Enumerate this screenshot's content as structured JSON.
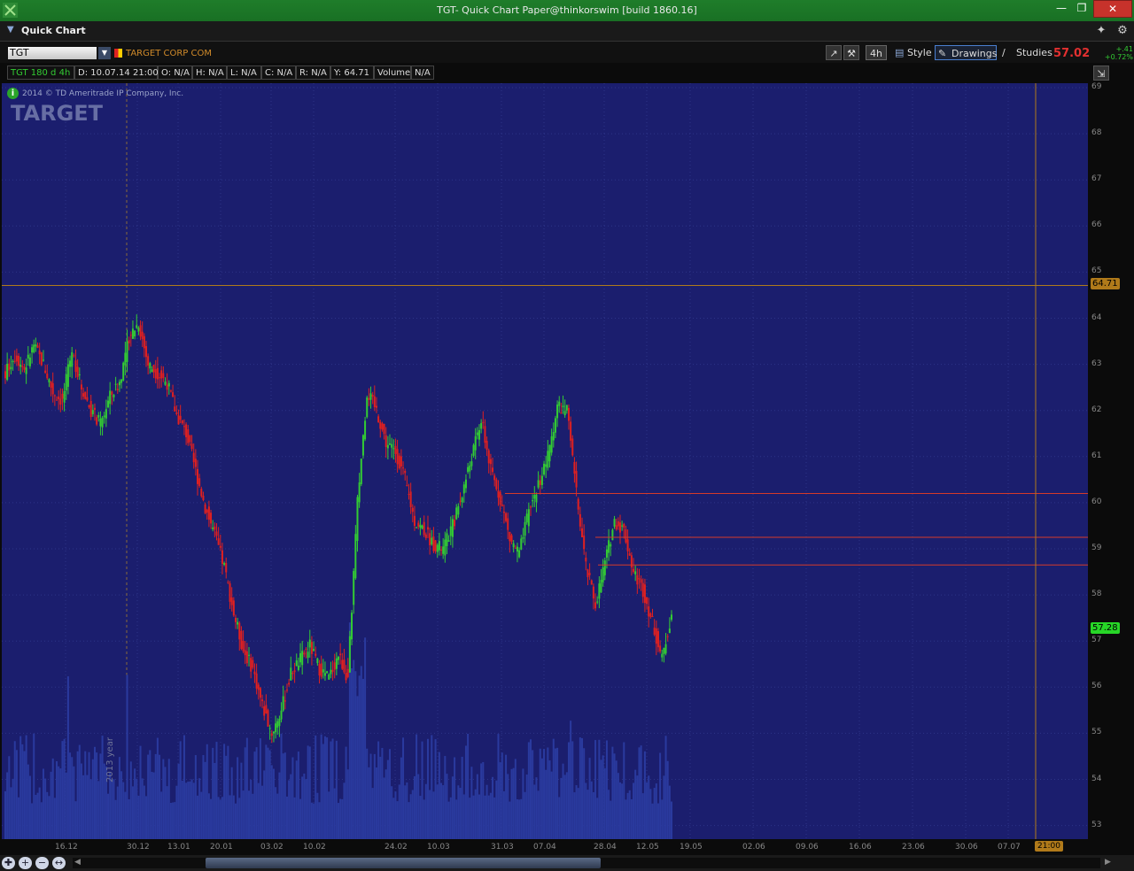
{
  "window": {
    "title": "TGT- Quick Chart Paper@thinkorswim [build 1860.16]"
  },
  "header": {
    "label": "Quick Chart"
  },
  "toolbar": {
    "symbol": "TGT",
    "company": "TARGET CORP COM",
    "aggregation": "4h",
    "style_label": "Style",
    "drawings_label": "Drawings",
    "studies_label": "Studies",
    "last_price": "57.02",
    "net_change": "+.41",
    "pct_change": "+0.72%"
  },
  "infobar": {
    "spec": "TGT 180 d 4h",
    "date": "D: 10.07.14 21:00",
    "open": "O: N/A",
    "high": "H: N/A",
    "low": "L: N/A",
    "close": "C: N/A",
    "range": "R: N/A",
    "y": "Y: 64.71",
    "volume_label": "Volume",
    "volume_value": "N/A"
  },
  "watermark": {
    "copyright": "2014 © TD Ameritrade IP Company, Inc.",
    "logo": "TARGET"
  },
  "year_marker": "2013 year",
  "price_labels": {
    "cursor": "64.71",
    "last": "57.28"
  },
  "time_label": "21:00",
  "colors": {
    "up": "#33cc33",
    "down": "#e02020",
    "background": "#1b1e6e",
    "volume": "#2a3a9e",
    "hline": "#d43a2a"
  },
  "chart_data": {
    "type": "candlestick",
    "y_ticks": [
      "69",
      "68",
      "67",
      "66",
      "65",
      "64",
      "63",
      "62",
      "61",
      "60",
      "59",
      "58",
      "57",
      "56",
      "55",
      "54",
      "53"
    ],
    "x_ticks": [
      "16.12",
      "30.12",
      "13.01",
      "20.01",
      "03.02",
      "10.02",
      "24.02",
      "10.03",
      "31.03",
      "07.04",
      "28.04",
      "12.05",
      "19.05",
      "02.06",
      "09.06",
      "16.06",
      "23.06",
      "30.06",
      "07.07"
    ],
    "ylim": [
      52.7,
      69.1
    ],
    "horizontal_lines": [
      60.2,
      59.25,
      58.65
    ],
    "close_series": [
      62.8,
      63.2,
      62.9,
      63.4,
      63.0,
      62.4,
      62.2,
      63.3,
      62.5,
      62.0,
      61.7,
      62.3,
      62.6,
      63.6,
      63.9,
      63.0,
      62.8,
      62.6,
      61.9,
      61.5,
      60.7,
      59.9,
      59.3,
      58.6,
      57.6,
      56.8,
      56.4,
      55.6,
      55.0,
      55.5,
      56.3,
      56.6,
      56.9,
      56.4,
      56.2,
      56.7,
      56.2,
      60.0,
      62.4,
      62.0,
      61.3,
      61.1,
      60.5,
      59.6,
      59.4,
      59.1,
      59.0,
      59.5,
      60.2,
      61.0,
      61.8,
      60.7,
      60.1,
      59.2,
      58.9,
      59.8,
      60.4,
      61.0,
      62.1,
      62.0,
      60.2,
      58.6,
      57.8,
      58.7,
      59.6,
      59.4,
      58.5,
      58.1,
      57.4,
      56.6,
      57.6
    ]
  }
}
